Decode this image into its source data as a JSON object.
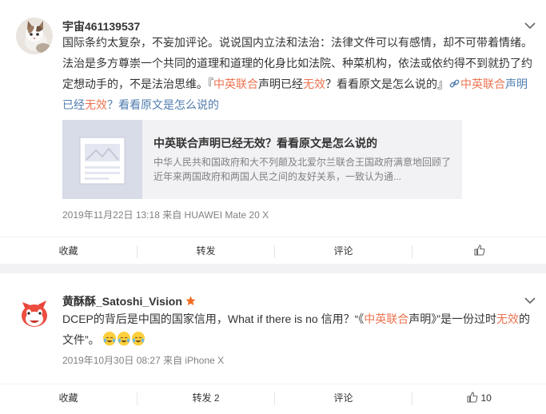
{
  "posts": [
    {
      "username": "宇宙461139537",
      "text_parts": [
        "国际条约太复杂，不妄加评论。说说国内立法和法治：法律文件可以有感情，却不可带着情绪。法治是多方尊崇一个共同的道理和道理的化身比如法院、种菜机构，依法或依约得不到就扔了约定想动手的，不是法治思维。『",
        "中英联合",
        "声明已经",
        "无效",
        "？看看原文是怎么说的』",
        "中英联合",
        "声明已经",
        "无效",
        "？看看原文是怎么说的"
      ],
      "link_card": {
        "title": "中英联合声明已经无效？看看原文是怎么说的",
        "desc": "中华人民共和国政府和大不列颠及北爱尔兰联合王国政府满意地回顾了近年来两国政府和两国人民之间的友好关系，一致认为通..."
      },
      "meta": "2019年11月22日 13:18  来自 HUAWEI Mate 20 X",
      "actions": {
        "collect": "收藏",
        "repost": "转发",
        "comment": "评论",
        "like": ""
      }
    },
    {
      "username": "黄酥酥_Satoshi_Vision",
      "text_parts": [
        "DCEP的背后是中国的国家信用，What if there is no 信用？“《",
        "中英联合",
        "声明》”是一份过时",
        "无效",
        "的文件”。"
      ],
      "meta": "2019年10月30日 08:27  来自 iPhone X",
      "actions": {
        "collect": "收藏",
        "repost": "转发 2",
        "comment": "评论",
        "like": "10"
      }
    }
  ],
  "icons": {
    "menu": "chevron-down-icon",
    "link": "link-icon",
    "like": "thumbs-up-icon",
    "vip": "star-badge-icon",
    "emoji": "laugh-cry-emoji-icon"
  },
  "colors": {
    "highlight": "#eb7350",
    "link": "#507daf",
    "meta": "#808080",
    "page_bg": "#f2f2f5"
  }
}
